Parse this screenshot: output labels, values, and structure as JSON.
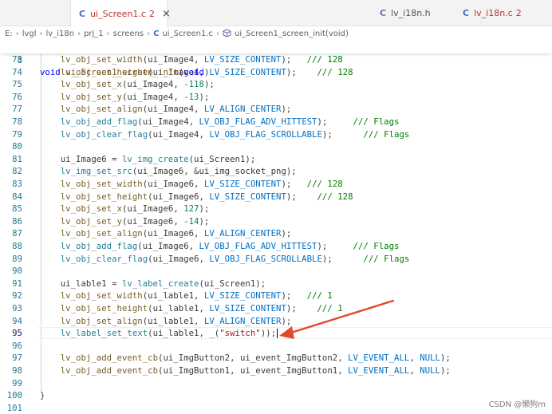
{
  "tabs": [
    {
      "icon": "C",
      "name": "ui_Screen1.c",
      "badge": "2",
      "active": true,
      "close": "×"
    },
    {
      "icon": "C",
      "name": "lv_i18n.h",
      "badge": "",
      "active": false
    },
    {
      "icon": "C",
      "name": "lv_i18n.c",
      "badge": "2",
      "active": false
    }
  ],
  "breadcrumb": {
    "items": [
      "E:",
      "lvgl",
      "lv_i18n",
      "prj_1",
      "screens",
      "ui_Screen1.c",
      "ui_Screen1_screen_init(void)"
    ],
    "file_icon": "C"
  },
  "editor": {
    "sticky": {
      "ln": "8",
      "text": "void ui_Screen1_screen_init(void)"
    },
    "lines": [
      {
        "ln": "73",
        "text": "    lv_obj_set_width(ui_Image4, LV_SIZE_CONTENT);   /// 128"
      },
      {
        "ln": "74",
        "text": "    lv_obj_set_height(ui_Image4, LV_SIZE_CONTENT);    /// 128"
      },
      {
        "ln": "75",
        "text": "    lv_obj_set_x(ui_Image4, -118);"
      },
      {
        "ln": "76",
        "text": "    lv_obj_set_y(ui_Image4, -13);"
      },
      {
        "ln": "77",
        "text": "    lv_obj_set_align(ui_Image4, LV_ALIGN_CENTER);"
      },
      {
        "ln": "78",
        "text": "    lv_obj_add_flag(ui_Image4, LV_OBJ_FLAG_ADV_HITTEST);     /// Flags"
      },
      {
        "ln": "79",
        "text": "    lv_obj_clear_flag(ui_Image4, LV_OBJ_FLAG_SCROLLABLE);      /// Flags"
      },
      {
        "ln": "80",
        "text": ""
      },
      {
        "ln": "81",
        "text": "    ui_Image6 = lv_img_create(ui_Screen1);"
      },
      {
        "ln": "82",
        "text": "    lv_img_set_src(ui_Image6, &ui_img_socket_png);"
      },
      {
        "ln": "83",
        "text": "    lv_obj_set_width(ui_Image6, LV_SIZE_CONTENT);   /// 128"
      },
      {
        "ln": "84",
        "text": "    lv_obj_set_height(ui_Image6, LV_SIZE_CONTENT);    /// 128"
      },
      {
        "ln": "85",
        "text": "    lv_obj_set_x(ui_Image6, 127);"
      },
      {
        "ln": "86",
        "text": "    lv_obj_set_y(ui_Image6, -14);"
      },
      {
        "ln": "87",
        "text": "    lv_obj_set_align(ui_Image6, LV_ALIGN_CENTER);"
      },
      {
        "ln": "88",
        "text": "    lv_obj_add_flag(ui_Image6, LV_OBJ_FLAG_ADV_HITTEST);     /// Flags"
      },
      {
        "ln": "89",
        "text": "    lv_obj_clear_flag(ui_Image6, LV_OBJ_FLAG_SCROLLABLE);      /// Flags"
      },
      {
        "ln": "90",
        "text": ""
      },
      {
        "ln": "91",
        "text": "    ui_lable1 = lv_label_create(ui_Screen1);"
      },
      {
        "ln": "92",
        "text": "    lv_obj_set_width(ui_lable1, LV_SIZE_CONTENT);   /// 1"
      },
      {
        "ln": "93",
        "text": "    lv_obj_set_height(ui_lable1, LV_SIZE_CONTENT);    /// 1"
      },
      {
        "ln": "94",
        "text": "    lv_obj_set_align(ui_lable1, LV_ALIGN_CENTER);"
      },
      {
        "ln": "95",
        "text": "    lv_label_set_text(ui_lable1, _(\"switch\"));"
      },
      {
        "ln": "96",
        "text": ""
      },
      {
        "ln": "97",
        "text": "    lv_obj_add_event_cb(ui_ImgButton2, ui_event_ImgButton2, LV_EVENT_ALL, NULL);"
      },
      {
        "ln": "98",
        "text": "    lv_obj_add_event_cb(ui_ImgButton1, ui_event_ImgButton1, LV_EVENT_ALL, NULL);"
      },
      {
        "ln": "99",
        "text": ""
      },
      {
        "ln": "100",
        "text": "}"
      },
      {
        "ln": "101",
        "text": ""
      }
    ]
  },
  "watermark": "CSDN @懒狗m",
  "colors": {
    "keyword": "#0000ff",
    "function": "#795e26",
    "macro": "#0070c1",
    "number": "#098658",
    "string": "#a31515",
    "comment": "#008000",
    "arrow": "#e04a2c"
  }
}
